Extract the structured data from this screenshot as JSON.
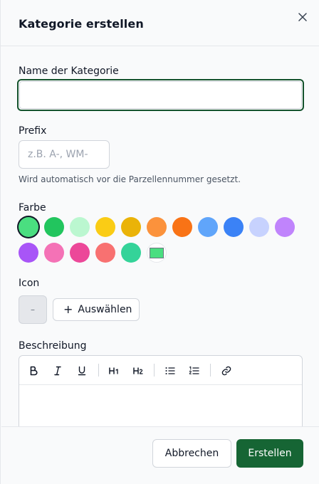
{
  "dialog": {
    "title": "Kategorie erstellen",
    "close_icon": "close-icon"
  },
  "name_field": {
    "label": "Name der Kategorie",
    "value": "",
    "placeholder": ""
  },
  "prefix_field": {
    "label": "Prefix",
    "value": "",
    "placeholder": "z.B. A-, WM-",
    "help": "Wird automatisch vor die Parzellennummer gesetzt."
  },
  "color": {
    "label": "Farbe",
    "selected": "#4ade80",
    "swatches": [
      "#4ade80",
      "#22c55e",
      "#bbf7d0",
      "#facc15",
      "#eab308",
      "#fb923c",
      "#f97316",
      "#60a5fa",
      "#3b82f6",
      "#c7d2fe",
      "#c084fc",
      "#a855f7",
      "#f472b6",
      "#ec4899",
      "#f87171",
      "#34d399"
    ],
    "custom_color": "#4ade80"
  },
  "icon": {
    "label": "Icon",
    "preview": "–",
    "choose_label": "Auswählen"
  },
  "description": {
    "label": "Beschreibung",
    "toolbar": [
      "bold-icon",
      "italic-icon",
      "underline-icon",
      "heading-1-icon",
      "heading-2-icon",
      "bullet-list-icon",
      "ordered-list-icon",
      "link-icon"
    ]
  },
  "footer": {
    "cancel_label": "Abbrechen",
    "create_label": "Erstellen"
  },
  "colors": {
    "primary": "#166534",
    "focus_ring": "#14532d"
  }
}
